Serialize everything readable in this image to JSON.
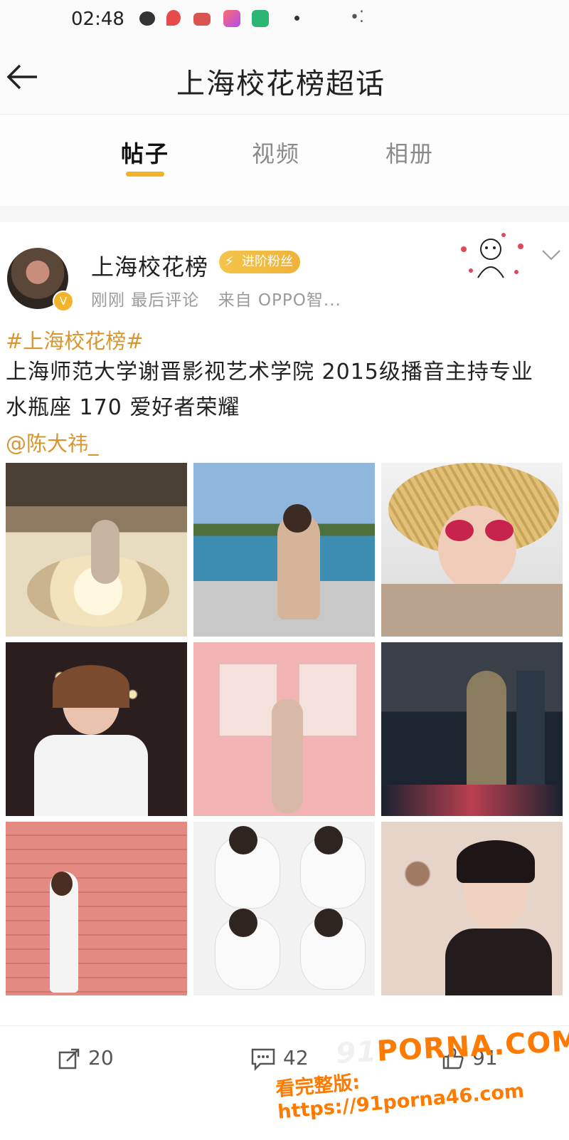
{
  "status_bar": {
    "time": "02:48"
  },
  "header": {
    "title": "上海校花榜超话"
  },
  "tabs": [
    {
      "label": "帖子",
      "active": true
    },
    {
      "label": "视频",
      "active": false
    },
    {
      "label": "相册",
      "active": false
    }
  ],
  "post": {
    "username": "上海校花榜",
    "badge": "进阶粉丝",
    "meta_time": "刚刚 最后评论",
    "meta_source": "来自 OPPO智...",
    "hashtag": "#上海校花榜#",
    "body": "上海师范大学谢晋影视艺术学院 2015级播音主持专业 水瓶座 170 爱好者荣耀",
    "mention": "@陈大祎_",
    "photos": [
      {
        "name": "photo-ball-pit"
      },
      {
        "name": "photo-poolside"
      },
      {
        "name": "photo-straw-hat"
      },
      {
        "name": "photo-drink-lights"
      },
      {
        "name": "photo-pink-wall"
      },
      {
        "name": "photo-city-window"
      },
      {
        "name": "photo-red-wall"
      },
      {
        "name": "photo-dog-collage"
      },
      {
        "name": "photo-portrait-bangs"
      }
    ]
  },
  "actions": {
    "share_count": "20",
    "comment_count": "42",
    "like_count": "91"
  },
  "watermark": {
    "logo_prefix": "91",
    "logo": "PORNA.COM",
    "url": "看完整版: https://91porna46.com"
  },
  "colors": {
    "accent": "#f0b228",
    "link": "#d89632",
    "badge": "#f4c44a",
    "watermark": "#ff7a00"
  }
}
